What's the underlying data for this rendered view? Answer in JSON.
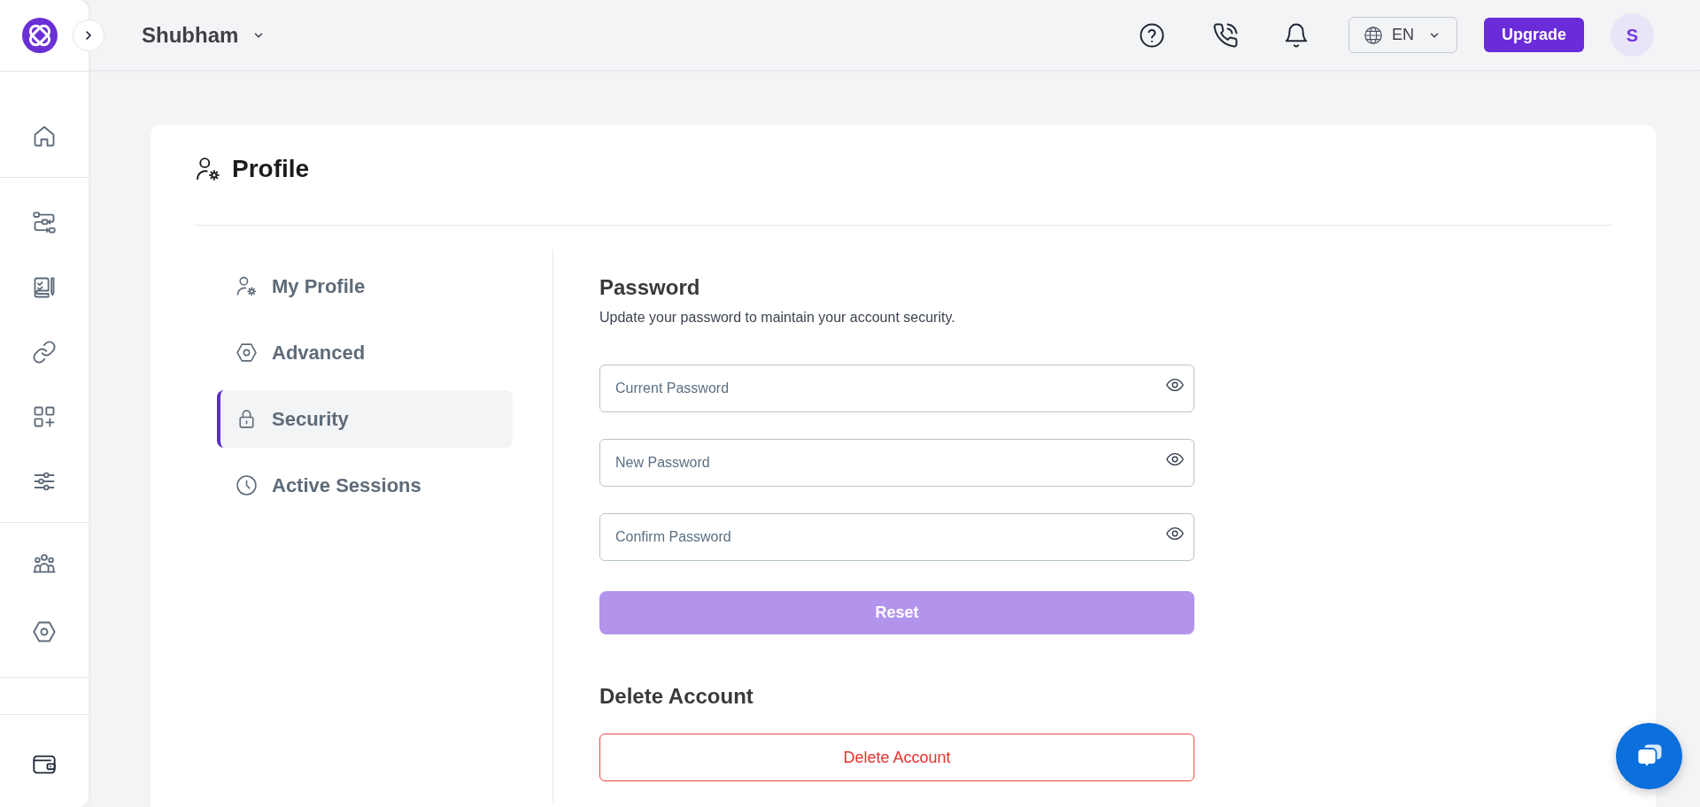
{
  "header": {
    "workspace": "Shubham",
    "language": "EN",
    "upgrade": "Upgrade",
    "avatar": "S"
  },
  "page": {
    "title": "Profile"
  },
  "profile_menu": [
    {
      "label": "My Profile",
      "selected": false
    },
    {
      "label": "Advanced",
      "selected": false
    },
    {
      "label": "Security",
      "selected": true
    },
    {
      "label": "Active Sessions",
      "selected": false
    }
  ],
  "password": {
    "title": "Password",
    "description": "Update your password to maintain your account security.",
    "fields": [
      {
        "placeholder": "Current Password"
      },
      {
        "placeholder": "New Password"
      },
      {
        "placeholder": "Confirm Password"
      }
    ],
    "reset": {
      "label": "Reset",
      "disabled": true
    }
  },
  "delete_account": {
    "title": "Delete Account",
    "button": "Delete Account"
  }
}
